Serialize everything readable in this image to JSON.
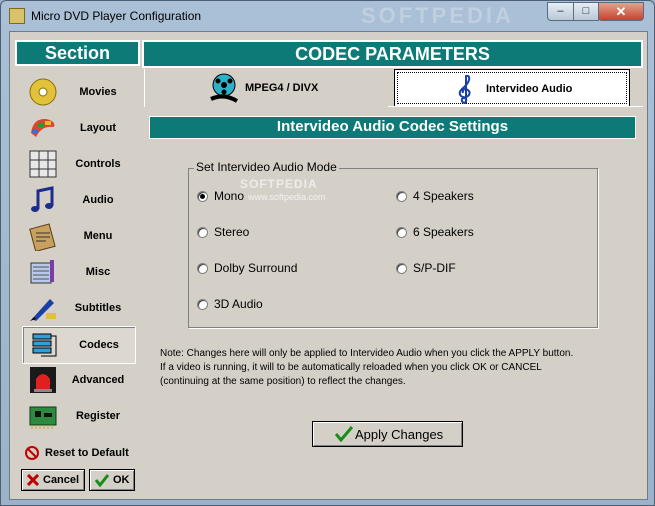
{
  "window": {
    "title": "Micro DVD Player Configuration",
    "watermark": "SOFTPEDIA"
  },
  "sidebar": {
    "header": "Section",
    "items": [
      {
        "label": "Movies",
        "icon": "dvd-disc-icon"
      },
      {
        "label": "Layout",
        "icon": "palette-icon"
      },
      {
        "label": "Controls",
        "icon": "controls-grid-icon"
      },
      {
        "label": "Audio",
        "icon": "music-notes-icon"
      },
      {
        "label": "Menu",
        "icon": "menu-clipboard-icon"
      },
      {
        "label": "Misc",
        "icon": "misc-tools-icon"
      },
      {
        "label": "Subtitles",
        "icon": "pen-icon"
      },
      {
        "label": "Codecs",
        "icon": "codec-stack-icon"
      },
      {
        "label": "Advanced",
        "icon": "advanced-siren-icon"
      },
      {
        "label": "Register",
        "icon": "circuit-board-icon"
      }
    ],
    "active": "Codecs",
    "reset_label": "Reset to Default",
    "cancel_label": "Cancel",
    "ok_label": "OK"
  },
  "main": {
    "header": "CODEC PARAMETERS",
    "tabs": [
      {
        "label": "MPEG4 / DIVX",
        "icon": "film-reel-icon"
      },
      {
        "label": "Intervideo Audio",
        "icon": "treble-clef-icon"
      }
    ],
    "active_tab": "Intervideo Audio",
    "section_title": "Intervideo Audio Codec Settings",
    "group_label": "Set Intervideo Audio Mode",
    "modes": [
      "Mono",
      "Stereo",
      "Dolby Surround",
      "3D Audio",
      "4 Speakers",
      "6 Speakers",
      "S/P-DIF"
    ],
    "selected_mode": "Mono",
    "watermark": "SOFTPEDIA",
    "watermark_url": "www.softpedia.com",
    "note": [
      "Note: Changes here will only be applied to Intervideo Audio when you click the APPLY button.",
      "If a video is running, it will to be automatically reloaded when you click OK or CANCEL",
      "(continuing at the same position) to reflect the changes."
    ],
    "apply_label": "Apply Changes"
  },
  "colors": {
    "accent": "#0d7a78",
    "checkmark": "#1a8c1a",
    "cancel_x": "#c00000"
  }
}
